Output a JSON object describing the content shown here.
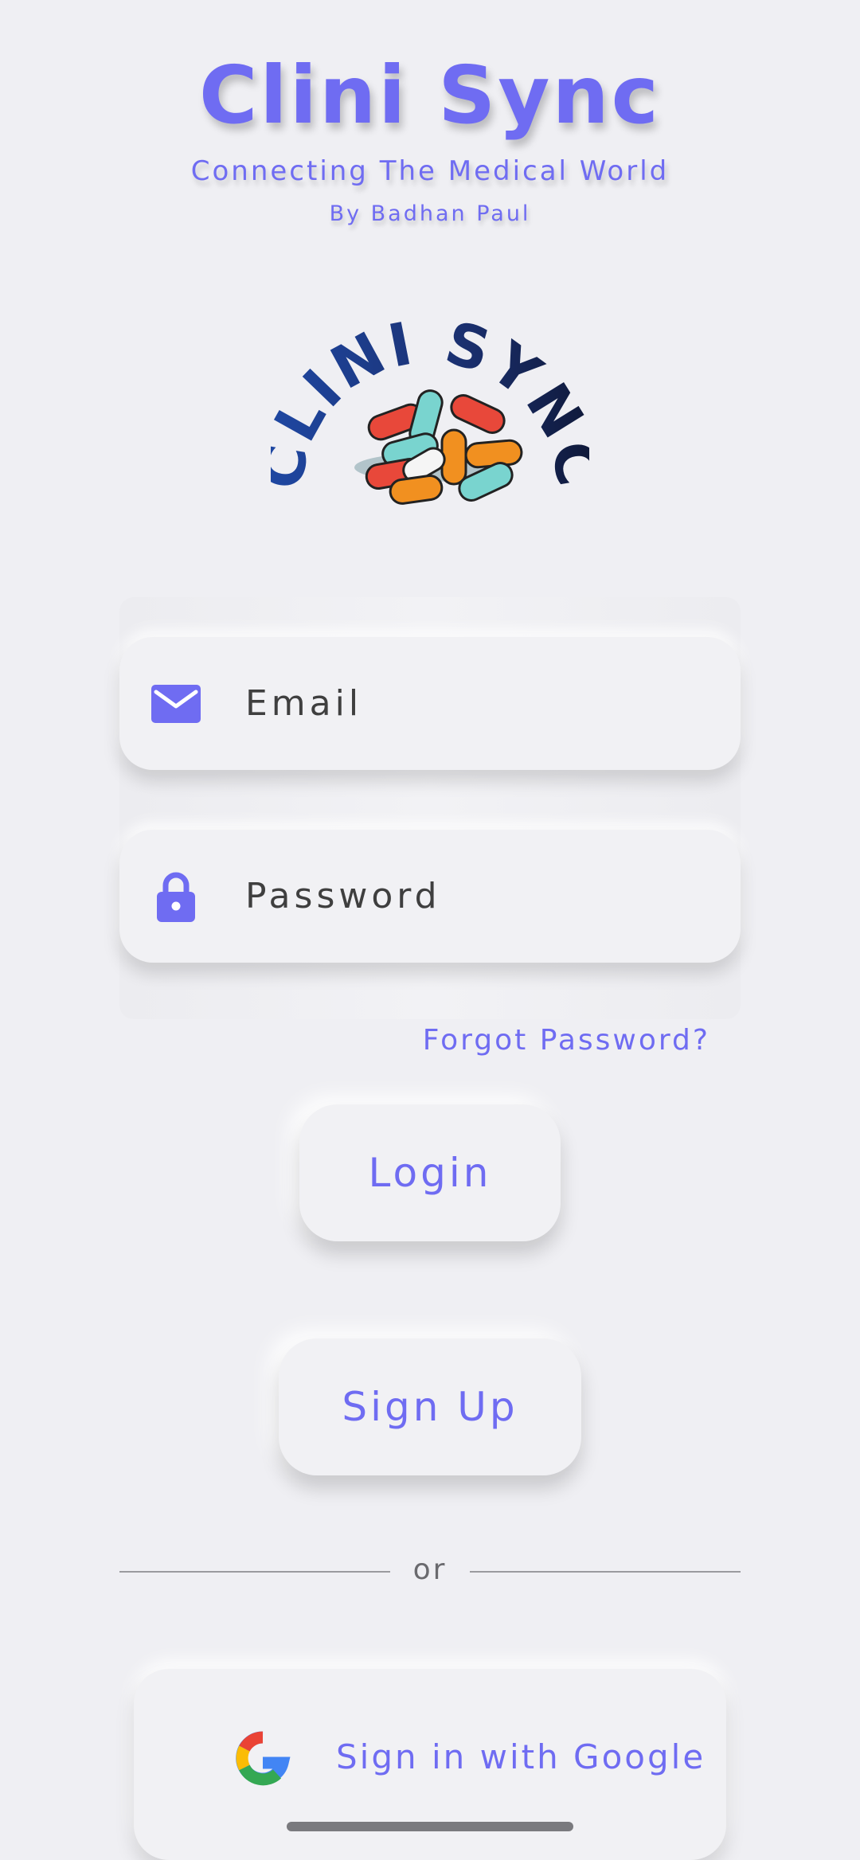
{
  "header": {
    "title": "Clini Sync",
    "subtitle": "Connecting The Medical World",
    "author": "By Badhan Paul"
  },
  "logo": {
    "text": "CLINI SYNC",
    "icon": "pills-logo"
  },
  "form": {
    "email": {
      "placeholder": "Email",
      "value": "",
      "icon": "mail-icon"
    },
    "password": {
      "placeholder": "Password",
      "value": "",
      "icon": "lock-icon"
    },
    "forgot_password": "Forgot Password?",
    "login_label": "Login",
    "signup_label": "Sign Up",
    "divider_text": "or",
    "google_label": "Sign in with Google"
  },
  "colors": {
    "accent": "#6f6cf2",
    "background": "#efeff3",
    "logo_text": "#1a2f6e"
  }
}
